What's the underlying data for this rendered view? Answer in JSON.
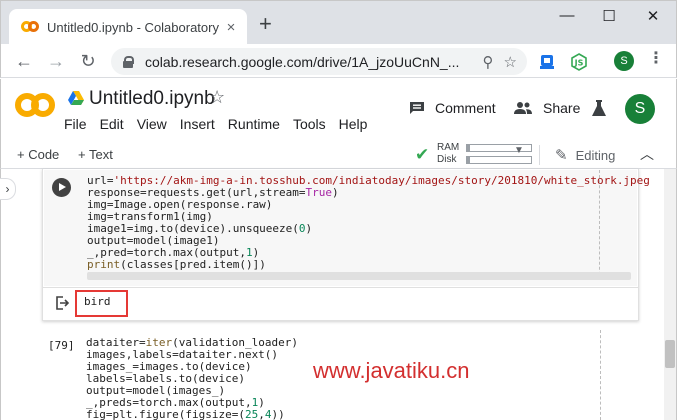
{
  "browser": {
    "tab_title": "Untitled0.ipynb - Colaboratory",
    "url": "colab.research.google.com/drive/1A_jzoUuCnN_..."
  },
  "icons": {
    "tab_close": "×",
    "new_tab": "+",
    "minimize": "—",
    "maximize": "☐",
    "close": "✕",
    "back": "←",
    "forward": "→",
    "reload": "↻",
    "search": "⚲",
    "bookmark": "☆",
    "notebook_star": "☆",
    "kebab": "⋮",
    "comment": "▇",
    "share": "👥",
    "lab": "⚗",
    "check": "✔",
    "caret": "▼",
    "pencil": "✎",
    "collapse": "︿",
    "side_handle": "›"
  },
  "profile": {
    "initial": "S"
  },
  "colab": {
    "notebook_title": "Untitled0.ipynb",
    "menu": [
      "File",
      "Edit",
      "View",
      "Insert",
      "Runtime",
      "Tools",
      "Help"
    ],
    "comment_label": "Comment",
    "share_label": "Share"
  },
  "toolbar": {
    "add_code": "+ Code",
    "add_text": "+ Text",
    "ram_label": "RAM",
    "disk_label": "Disk",
    "ram_fraction": 0.05,
    "disk_fraction": 0.05,
    "editing_label": "Editing"
  },
  "cell1": {
    "lines": [
      [
        "url=",
        {
          "t": "'https://akm-img-a-in.tosshub.com/indiatoday/images/story/201810/white_stork.jpeg",
          "c": "str"
        }
      ],
      [
        "response=requests.get(url,stream=",
        {
          "t": "True",
          "c": "kw"
        },
        ")"
      ],
      [
        "img=Image.open(response.raw)"
      ],
      [
        "img=transform1(img)"
      ],
      [
        "image1=img.to(device).unsqueeze(",
        {
          "t": "0",
          "c": "num"
        },
        ")"
      ],
      [
        "output=model(image1)"
      ],
      [
        "_,pred=torch.max(output,",
        {
          "t": "1",
          "c": "num"
        },
        ")"
      ],
      [
        {
          "t": "print",
          "c": "bi"
        },
        "(classes[pred.item()])"
      ]
    ],
    "output": "bird"
  },
  "cell2": {
    "exec_count": "[79]",
    "lines": [
      [
        "dataiter=",
        {
          "t": "iter",
          "c": "bi"
        },
        "(validation_loader)"
      ],
      [
        "images,labels=dataiter.next()"
      ],
      [
        "images_=images.to(device)"
      ],
      [
        "labels=labels.to(device)"
      ],
      [
        "output=model(images_)"
      ],
      [
        "_,preds=torch.max(output,",
        {
          "t": "1",
          "c": "num"
        },
        ")"
      ],
      [
        "fig=plt.figure(figsize=(",
        {
          "t": "25",
          "c": "num"
        },
        ",",
        {
          "t": "4",
          "c": "num"
        },
        "))"
      ]
    ]
  },
  "watermark": "www.javatiku.cn",
  "colors": {
    "colab_orange": "#f9ab00",
    "profile_green": "#188038",
    "highlight_red": "#e53935",
    "watermark_red": "#d32f2f"
  }
}
